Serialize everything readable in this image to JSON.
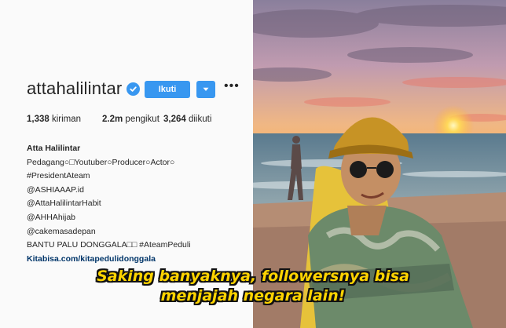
{
  "profile": {
    "username": "attahalilintar",
    "follow_label": "Ikuti",
    "stats": {
      "posts": "1,338",
      "posts_label": "kiriman",
      "followers": "2.2m",
      "followers_label": "pengikut",
      "following": "3,264",
      "following_label": "diikuti"
    },
    "bio": {
      "name": "Atta Halilintar",
      "lines": [
        "Pedagang○□Youtuber○Producer○Actor○",
        "#PresidentAteam",
        "@ASHIAAAP.id",
        "@AttaHalilintarHabit",
        "@AHHAhijab",
        "@cakemasadepan",
        "BANTU PALU DONGGALA□□ #AteamPeduli"
      ],
      "link": "Kitabisa.com/kitapedulidonggala"
    }
  },
  "caption": {
    "line1": "Saking banyaknya, followersnya bisa",
    "line2": "menjajah negara lain!"
  },
  "colors": {
    "accent": "#3897f0",
    "caption_text": "#ffd400"
  }
}
